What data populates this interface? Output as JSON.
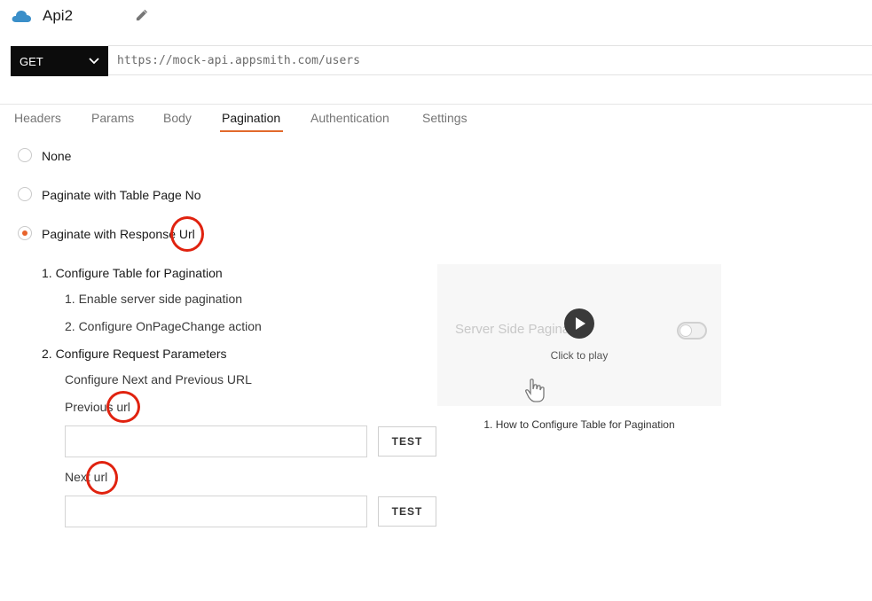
{
  "header": {
    "api_name": "Api2",
    "cloud_icon": "cloud-icon",
    "edit_icon": "pencil-icon"
  },
  "request": {
    "method": "GET",
    "url": "https://mock-api.appsmith.com/users"
  },
  "tabs": [
    {
      "label": "Headers"
    },
    {
      "label": "Params"
    },
    {
      "label": "Body"
    },
    {
      "label": "Pagination",
      "active": true
    },
    {
      "label": "Authentication"
    },
    {
      "label": "Settings"
    }
  ],
  "pagination": {
    "options": [
      {
        "label": "None",
        "checked": false
      },
      {
        "label": "Paginate with Table Page No",
        "checked": false
      },
      {
        "label": "Paginate with Response Url",
        "checked": true
      }
    ],
    "step1": "1. Configure Table for Pagination",
    "step1_sub1": "1. Enable server side pagination",
    "step1_sub2": "2. Configure OnPageChange action",
    "step2": "2. Configure Request Parameters",
    "step2_desc": "Configure Next and Previous URL",
    "previous_label": "Previous url",
    "next_label": "Next url",
    "test_label": "TEST",
    "previous_value": "",
    "next_value": ""
  },
  "video": {
    "title": "Server Side Pagination",
    "click_to_play": "Click to play",
    "caption": "1. How to Configure Table for Pagination"
  },
  "colors": {
    "accent": "#e8632b",
    "annotation": "#e0220f",
    "method_bg": "#0c0c0c"
  }
}
